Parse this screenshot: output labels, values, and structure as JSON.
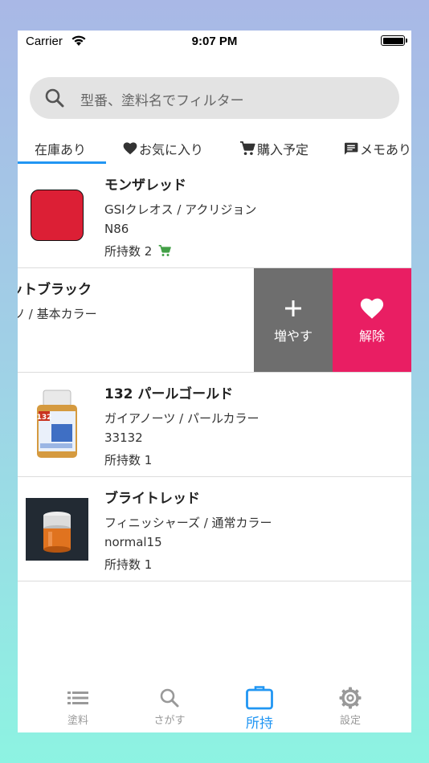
{
  "status_bar": {
    "carrier": "Carrier",
    "time": "9:07 PM"
  },
  "search": {
    "placeholder": "型番、塗料名でフィルター"
  },
  "tabs": [
    {
      "label": "在庫あり",
      "icon": "none",
      "active": true
    },
    {
      "label": "お気に入り",
      "icon": "heart-icon"
    },
    {
      "label": "購入予定",
      "icon": "cart-icon"
    },
    {
      "label": "メモあり",
      "icon": "memo-icon"
    }
  ],
  "items": [
    {
      "name": "モンザレッド",
      "maker": "GSIクレオス / アクリジョン",
      "code": "N86",
      "count": "所持数 2",
      "swatch_color": "#dc1f35",
      "has_cart": true
    },
    {
      "name": "ットブラック",
      "maker": "ソ / 基本カラー",
      "code": "",
      "count": "",
      "swiped": true
    },
    {
      "name": "132 パールゴールド",
      "maker": "ガイアノーツ / パールカラー",
      "code": "33132",
      "count": "所持数 1",
      "bottle_label": "132"
    },
    {
      "name": "ブライトレッド",
      "maker": "フィニッシャーズ / 通常カラー",
      "code": "normal15",
      "count": "所持数 1"
    }
  ],
  "swipe_actions": {
    "add_label": "増やす",
    "unfavorite_label": "解除",
    "add_color": "#6e6e6e",
    "unfavorite_color": "#e91e63"
  },
  "bottom_nav": [
    {
      "label": "塗料",
      "icon": "list-icon"
    },
    {
      "label": "さがす",
      "icon": "search-icon"
    },
    {
      "label": "所持",
      "icon": "briefcase-icon",
      "active": true
    },
    {
      "label": "設定",
      "icon": "gear-icon"
    }
  ],
  "colors": {
    "accent": "#2196f3",
    "cart_green": "#43a047"
  }
}
